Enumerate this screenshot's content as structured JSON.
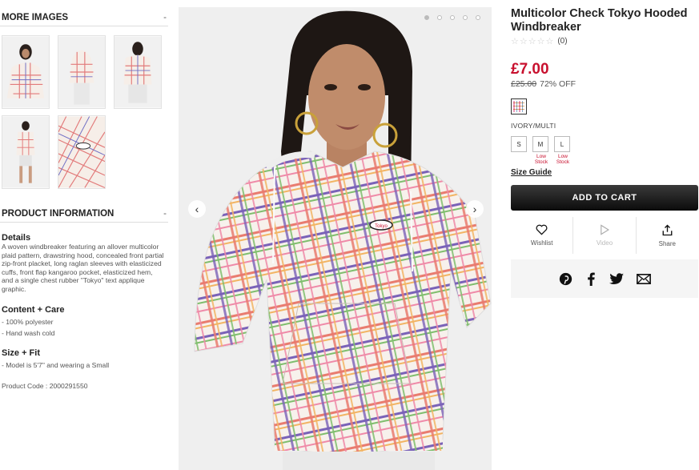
{
  "more_images": {
    "title": "MORE IMAGES",
    "toggle": "-"
  },
  "product_info": {
    "title": "PRODUCT INFORMATION",
    "toggle": "-",
    "details_heading": "Details",
    "details_text": "A woven windbreaker featuring an allover multicolor plaid pattern, drawstring hood, concealed front partial zip-front placket, long raglan sleeves with elasticized cuffs, front flap kangaroo pocket, elasticized hem, and a single chest rubber \"Tokyo\" text applique graphic.",
    "content_heading": "Content + Care",
    "content_items": [
      "- 100% polyester",
      "- Hand wash cold"
    ],
    "fit_heading": "Size + Fit",
    "fit_items": [
      "- Model is 5'7\" and wearing a Small"
    ],
    "product_code": "Product Code : 2000291550"
  },
  "gallery": {
    "slides": 5,
    "active_slide": 1,
    "patch_text": "Tokyo"
  },
  "product": {
    "title": "Multicolor Check Tokyo Hooded Windbreaker",
    "stars": "☆☆☆☆☆",
    "review_count": "(0)",
    "price": "£7.00",
    "original_price": "£25.00",
    "discount": "72% OFF",
    "color_name": "IVORY/MULTI",
    "sizes": [
      {
        "label": "S",
        "note": ""
      },
      {
        "label": "M",
        "note": "Low Stock"
      },
      {
        "label": "L",
        "note": "Low Stock"
      }
    ],
    "size_guide": "Size Guide",
    "add_to_cart": "ADD TO CART",
    "actions": {
      "wishlist": "Wishlist",
      "video": "Video",
      "share": "Share"
    }
  },
  "colors": {
    "price_red": "#c8102e",
    "cart_black": "#111111"
  }
}
